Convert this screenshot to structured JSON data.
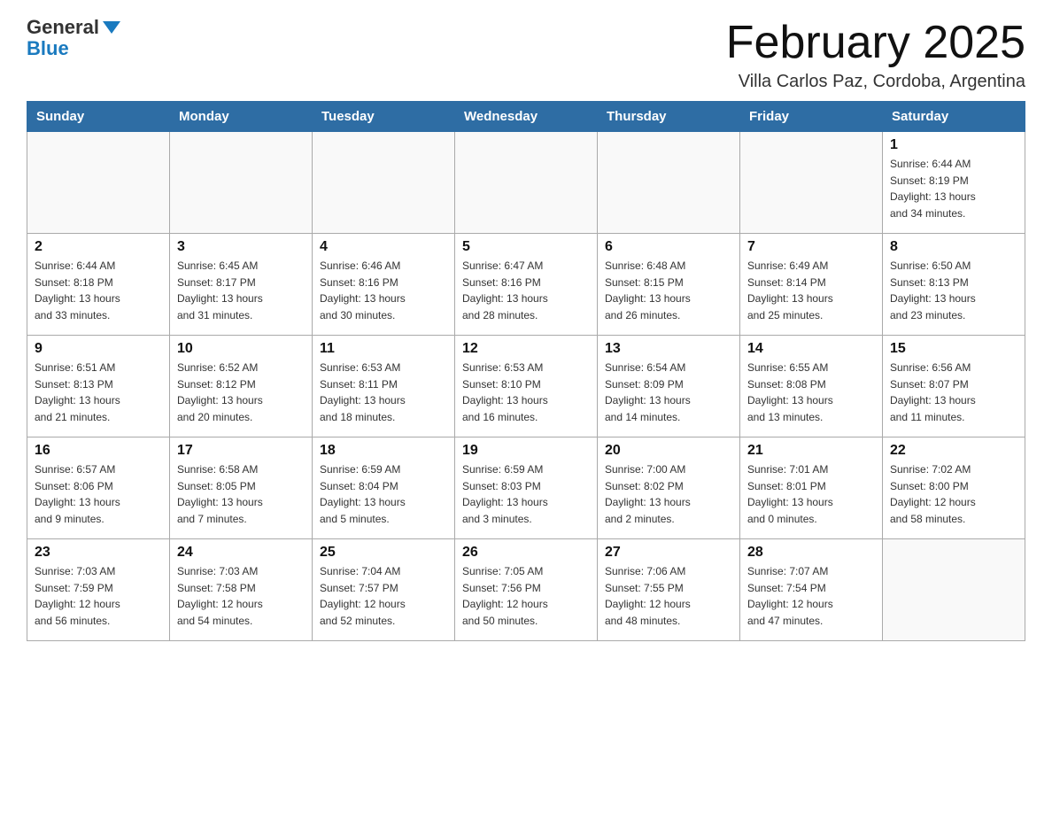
{
  "header": {
    "logo_line1": "General",
    "logo_line2": "Blue",
    "month_title": "February 2025",
    "subtitle": "Villa Carlos Paz, Cordoba, Argentina"
  },
  "weekdays": [
    "Sunday",
    "Monday",
    "Tuesday",
    "Wednesday",
    "Thursday",
    "Friday",
    "Saturday"
  ],
  "weeks": [
    [
      {
        "day": "",
        "info": ""
      },
      {
        "day": "",
        "info": ""
      },
      {
        "day": "",
        "info": ""
      },
      {
        "day": "",
        "info": ""
      },
      {
        "day": "",
        "info": ""
      },
      {
        "day": "",
        "info": ""
      },
      {
        "day": "1",
        "info": "Sunrise: 6:44 AM\nSunset: 8:19 PM\nDaylight: 13 hours\nand 34 minutes."
      }
    ],
    [
      {
        "day": "2",
        "info": "Sunrise: 6:44 AM\nSunset: 8:18 PM\nDaylight: 13 hours\nand 33 minutes."
      },
      {
        "day": "3",
        "info": "Sunrise: 6:45 AM\nSunset: 8:17 PM\nDaylight: 13 hours\nand 31 minutes."
      },
      {
        "day": "4",
        "info": "Sunrise: 6:46 AM\nSunset: 8:16 PM\nDaylight: 13 hours\nand 30 minutes."
      },
      {
        "day": "5",
        "info": "Sunrise: 6:47 AM\nSunset: 8:16 PM\nDaylight: 13 hours\nand 28 minutes."
      },
      {
        "day": "6",
        "info": "Sunrise: 6:48 AM\nSunset: 8:15 PM\nDaylight: 13 hours\nand 26 minutes."
      },
      {
        "day": "7",
        "info": "Sunrise: 6:49 AM\nSunset: 8:14 PM\nDaylight: 13 hours\nand 25 minutes."
      },
      {
        "day": "8",
        "info": "Sunrise: 6:50 AM\nSunset: 8:13 PM\nDaylight: 13 hours\nand 23 minutes."
      }
    ],
    [
      {
        "day": "9",
        "info": "Sunrise: 6:51 AM\nSunset: 8:13 PM\nDaylight: 13 hours\nand 21 minutes."
      },
      {
        "day": "10",
        "info": "Sunrise: 6:52 AM\nSunset: 8:12 PM\nDaylight: 13 hours\nand 20 minutes."
      },
      {
        "day": "11",
        "info": "Sunrise: 6:53 AM\nSunset: 8:11 PM\nDaylight: 13 hours\nand 18 minutes."
      },
      {
        "day": "12",
        "info": "Sunrise: 6:53 AM\nSunset: 8:10 PM\nDaylight: 13 hours\nand 16 minutes."
      },
      {
        "day": "13",
        "info": "Sunrise: 6:54 AM\nSunset: 8:09 PM\nDaylight: 13 hours\nand 14 minutes."
      },
      {
        "day": "14",
        "info": "Sunrise: 6:55 AM\nSunset: 8:08 PM\nDaylight: 13 hours\nand 13 minutes."
      },
      {
        "day": "15",
        "info": "Sunrise: 6:56 AM\nSunset: 8:07 PM\nDaylight: 13 hours\nand 11 minutes."
      }
    ],
    [
      {
        "day": "16",
        "info": "Sunrise: 6:57 AM\nSunset: 8:06 PM\nDaylight: 13 hours\nand 9 minutes."
      },
      {
        "day": "17",
        "info": "Sunrise: 6:58 AM\nSunset: 8:05 PM\nDaylight: 13 hours\nand 7 minutes."
      },
      {
        "day": "18",
        "info": "Sunrise: 6:59 AM\nSunset: 8:04 PM\nDaylight: 13 hours\nand 5 minutes."
      },
      {
        "day": "19",
        "info": "Sunrise: 6:59 AM\nSunset: 8:03 PM\nDaylight: 13 hours\nand 3 minutes."
      },
      {
        "day": "20",
        "info": "Sunrise: 7:00 AM\nSunset: 8:02 PM\nDaylight: 13 hours\nand 2 minutes."
      },
      {
        "day": "21",
        "info": "Sunrise: 7:01 AM\nSunset: 8:01 PM\nDaylight: 13 hours\nand 0 minutes."
      },
      {
        "day": "22",
        "info": "Sunrise: 7:02 AM\nSunset: 8:00 PM\nDaylight: 12 hours\nand 58 minutes."
      }
    ],
    [
      {
        "day": "23",
        "info": "Sunrise: 7:03 AM\nSunset: 7:59 PM\nDaylight: 12 hours\nand 56 minutes."
      },
      {
        "day": "24",
        "info": "Sunrise: 7:03 AM\nSunset: 7:58 PM\nDaylight: 12 hours\nand 54 minutes."
      },
      {
        "day": "25",
        "info": "Sunrise: 7:04 AM\nSunset: 7:57 PM\nDaylight: 12 hours\nand 52 minutes."
      },
      {
        "day": "26",
        "info": "Sunrise: 7:05 AM\nSunset: 7:56 PM\nDaylight: 12 hours\nand 50 minutes."
      },
      {
        "day": "27",
        "info": "Sunrise: 7:06 AM\nSunset: 7:55 PM\nDaylight: 12 hours\nand 48 minutes."
      },
      {
        "day": "28",
        "info": "Sunrise: 7:07 AM\nSunset: 7:54 PM\nDaylight: 12 hours\nand 47 minutes."
      },
      {
        "day": "",
        "info": ""
      }
    ]
  ]
}
